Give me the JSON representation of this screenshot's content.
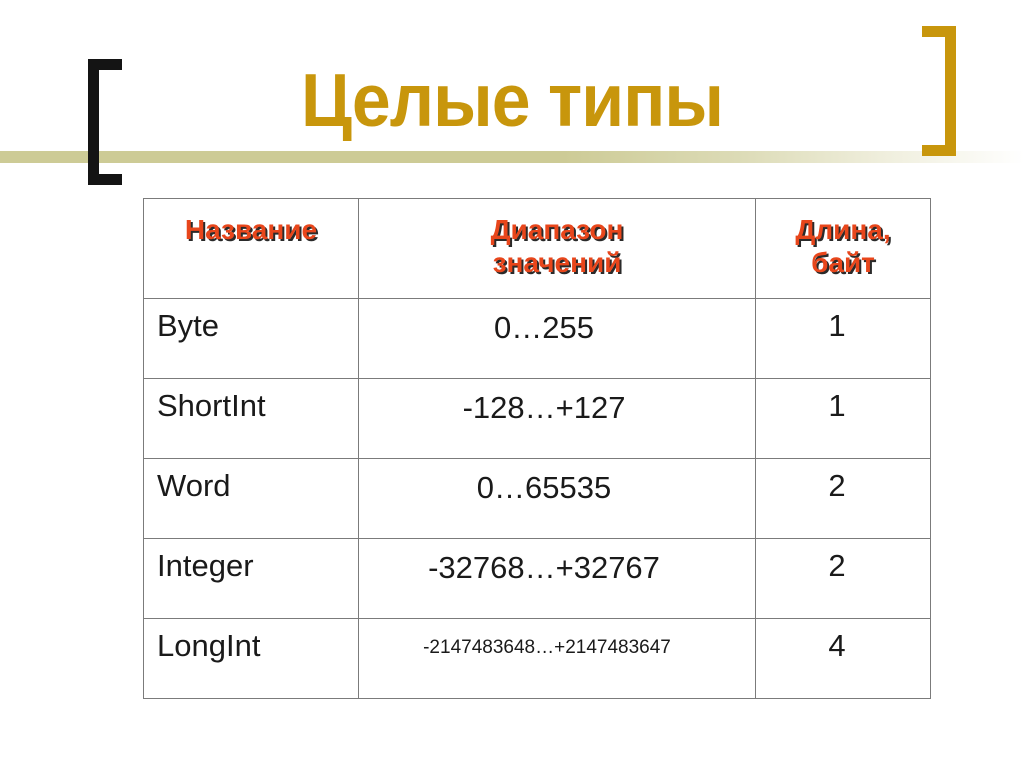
{
  "slide": {
    "title": "Целые типы",
    "decor": {
      "left_bracket": "open-bracket",
      "right_bracket": "close-bracket",
      "band_color": "#cdcb96",
      "title_color": "#c8960c",
      "header_text_color": "#e8461b",
      "body_text_color": "#1a1a1a",
      "border_color": "#7b7b7b",
      "background_color": "#ffffff"
    }
  },
  "table": {
    "headers": [
      "Название",
      "Диапазон\nзначений",
      "Длина,\nбайт"
    ],
    "header_lines": {
      "col1": [
        "Название"
      ],
      "col2": [
        "Диапазон",
        "значений"
      ],
      "col3": [
        "Длина,",
        "байт"
      ]
    },
    "rows": [
      {
        "name": "Byte",
        "range": "0…255",
        "size": "1",
        "range_small": false
      },
      {
        "name": "ShortInt",
        "range": "-128…+127",
        "size": "1",
        "range_small": false
      },
      {
        "name": "Word",
        "range": "0…65535",
        "size": "2",
        "range_small": false
      },
      {
        "name": "Integer",
        "range": "-32768…+32767",
        "size": "2",
        "range_small": false
      },
      {
        "name": "LongInt",
        "range": "-2147483648…+2147483647",
        "size": "4",
        "range_small": true
      }
    ]
  }
}
